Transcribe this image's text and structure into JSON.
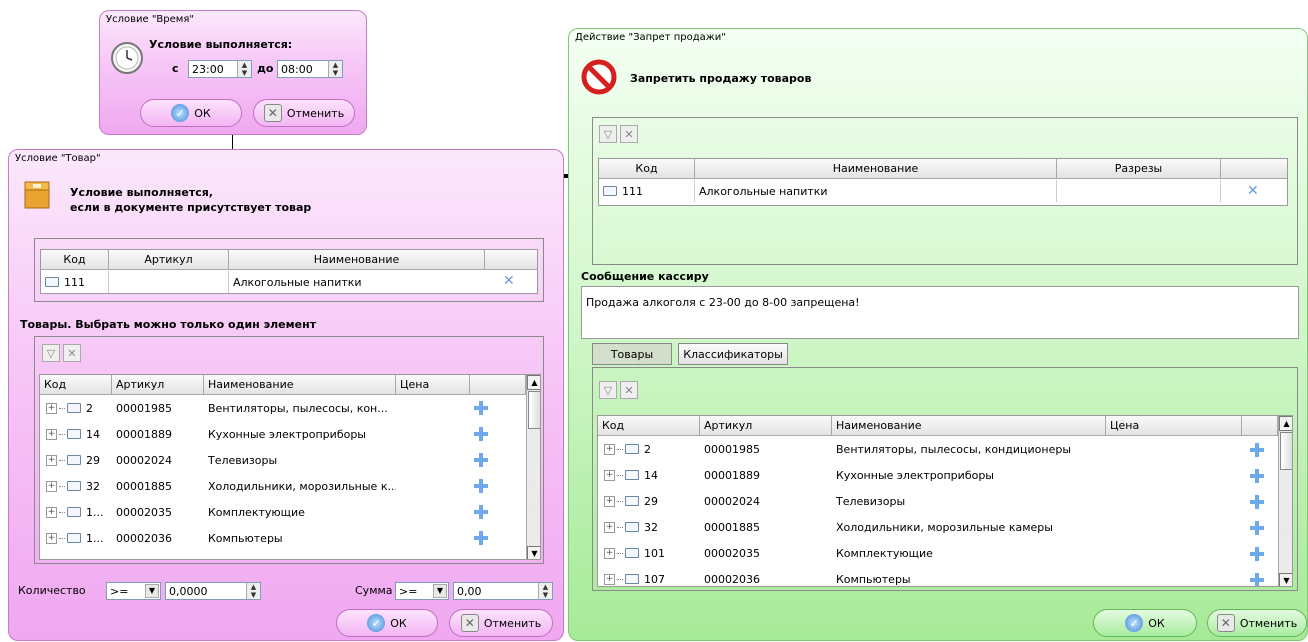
{
  "time_panel": {
    "title": "Условие \"Время\"",
    "heading": "Условие выполняется:",
    "from_label": "с",
    "from_value": "23:00",
    "to_label": "до",
    "to_value": "08:00",
    "ok": "ОК",
    "cancel": "Отменить"
  },
  "goods_panel": {
    "title": "Условие \"Товар\"",
    "heading_line1": "Условие выполняется,",
    "heading_line2": "если в документе присутствует товар",
    "selected_grid": {
      "headers": [
        "Код",
        "Артикул",
        "Наименование",
        ""
      ],
      "rows": [
        {
          "code": "111",
          "article": "",
          "name": "Алкогольные напитки"
        }
      ]
    },
    "list_title": "Товары. Выбрать можно только один элемент",
    "list_grid": {
      "headers": [
        "Код",
        "Артикул",
        "Наименование",
        "Цена",
        ""
      ],
      "rows": [
        {
          "code": "2",
          "article": "00001985",
          "name": "Вентиляторы, пылесосы, кон..."
        },
        {
          "code": "14",
          "article": "00001889",
          "name": "Кухонные электроприборы"
        },
        {
          "code": "29",
          "article": "00002024",
          "name": "Телевизоры"
        },
        {
          "code": "32",
          "article": "00001885",
          "name": "Холодильники, морозильные к..."
        },
        {
          "code": "1...",
          "article": "00002035",
          "name": "Комплектующие"
        },
        {
          "code": "1...",
          "article": "00002036",
          "name": "Компьютеры"
        }
      ]
    },
    "qty_label": "Количество",
    "qty_op": ">=",
    "qty_value": "0,0000",
    "sum_label": "Сумма",
    "sum_op": ">=",
    "sum_value": "0,00",
    "ok": "ОК",
    "cancel": "Отменить"
  },
  "action_panel": {
    "title": "Действие \"Запрет продажи\"",
    "heading": "Запретить продажу товаров",
    "selected_grid": {
      "headers": [
        "Код",
        "Наименование",
        "Разрезы",
        ""
      ],
      "rows": [
        {
          "code": "111",
          "name": "Алкогольные напитки",
          "cuts": ""
        }
      ]
    },
    "message_label": "Сообщение кассиру",
    "message_value": "Продажа алкоголя с 23-00 до 8-00 запрещена!",
    "tabs": [
      "Товары",
      "Классификаторы"
    ],
    "list_grid": {
      "headers": [
        "Код",
        "Артикул",
        "Наименование",
        "Цена",
        ""
      ],
      "rows": [
        {
          "code": "2",
          "article": "00001985",
          "name": "Вентиляторы, пылесосы, кондиционеры"
        },
        {
          "code": "14",
          "article": "00001889",
          "name": "Кухонные электроприборы"
        },
        {
          "code": "29",
          "article": "00002024",
          "name": "Телевизоры"
        },
        {
          "code": "32",
          "article": "00001885",
          "name": "Холодильники, морозильные камеры"
        },
        {
          "code": "101",
          "article": "00002035",
          "name": "Комплектующие"
        },
        {
          "code": "107",
          "article": "00002036",
          "name": "Компьютеры"
        }
      ]
    },
    "ok": "ОК",
    "cancel": "Отменить"
  }
}
